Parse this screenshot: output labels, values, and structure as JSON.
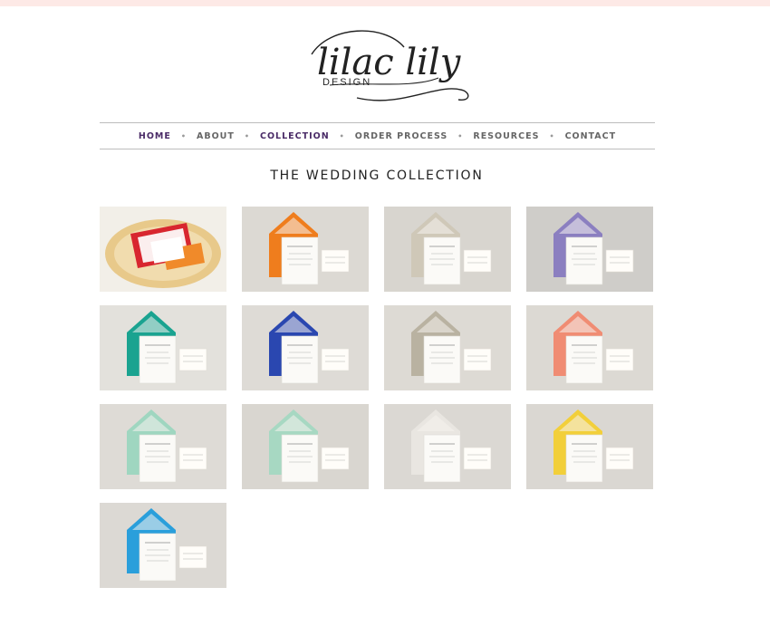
{
  "logo": {
    "script": "lilac lily",
    "sub": "DESIGN"
  },
  "nav": {
    "items": [
      {
        "label": "HOME",
        "active": true
      },
      {
        "label": "ABOUT",
        "active": false
      },
      {
        "label": "COLLECTION",
        "active": true
      },
      {
        "label": "ORDER PROCESS",
        "active": false
      },
      {
        "label": "RESOURCES",
        "active": false
      },
      {
        "label": "CONTACT",
        "active": false
      }
    ],
    "separator": "•"
  },
  "heading": "THE WEDDING COLLECTION",
  "colors": {
    "top_bar": "#fde9e6",
    "nav_active": "#4a2b67",
    "nav_text": "#666666"
  },
  "collection": [
    {
      "background": "#f2efe8",
      "accent": "#d8262f",
      "style": "plate"
    },
    {
      "background": "#dcd9d3",
      "accent": "#ef7d1d",
      "style": "envelope"
    },
    {
      "background": "#d8d5cf",
      "accent": "#cfc8b8",
      "style": "envelope"
    },
    {
      "background": "#cfcdc9",
      "accent": "#8b7fc0",
      "style": "envelope"
    },
    {
      "background": "#e3e1dc",
      "accent": "#1aa390",
      "style": "envelope"
    },
    {
      "background": "#dedbd6",
      "accent": "#2a47b0",
      "style": "envelope"
    },
    {
      "background": "#dddad4",
      "accent": "#b9b2a1",
      "style": "envelope"
    },
    {
      "background": "#dcd9d3",
      "accent": "#f08c73",
      "style": "envelope"
    },
    {
      "background": "#dedbd6",
      "accent": "#9fd6c0",
      "style": "envelope"
    },
    {
      "background": "#d9d6d0",
      "accent": "#a7d8c2",
      "style": "envelope"
    },
    {
      "background": "#dbd8d3",
      "accent": "#e9e6e1",
      "style": "envelope"
    },
    {
      "background": "#dad7d2",
      "accent": "#f2cf3a",
      "style": "envelope"
    },
    {
      "background": "#dcd9d4",
      "accent": "#2a9fdb",
      "style": "envelope"
    }
  ]
}
